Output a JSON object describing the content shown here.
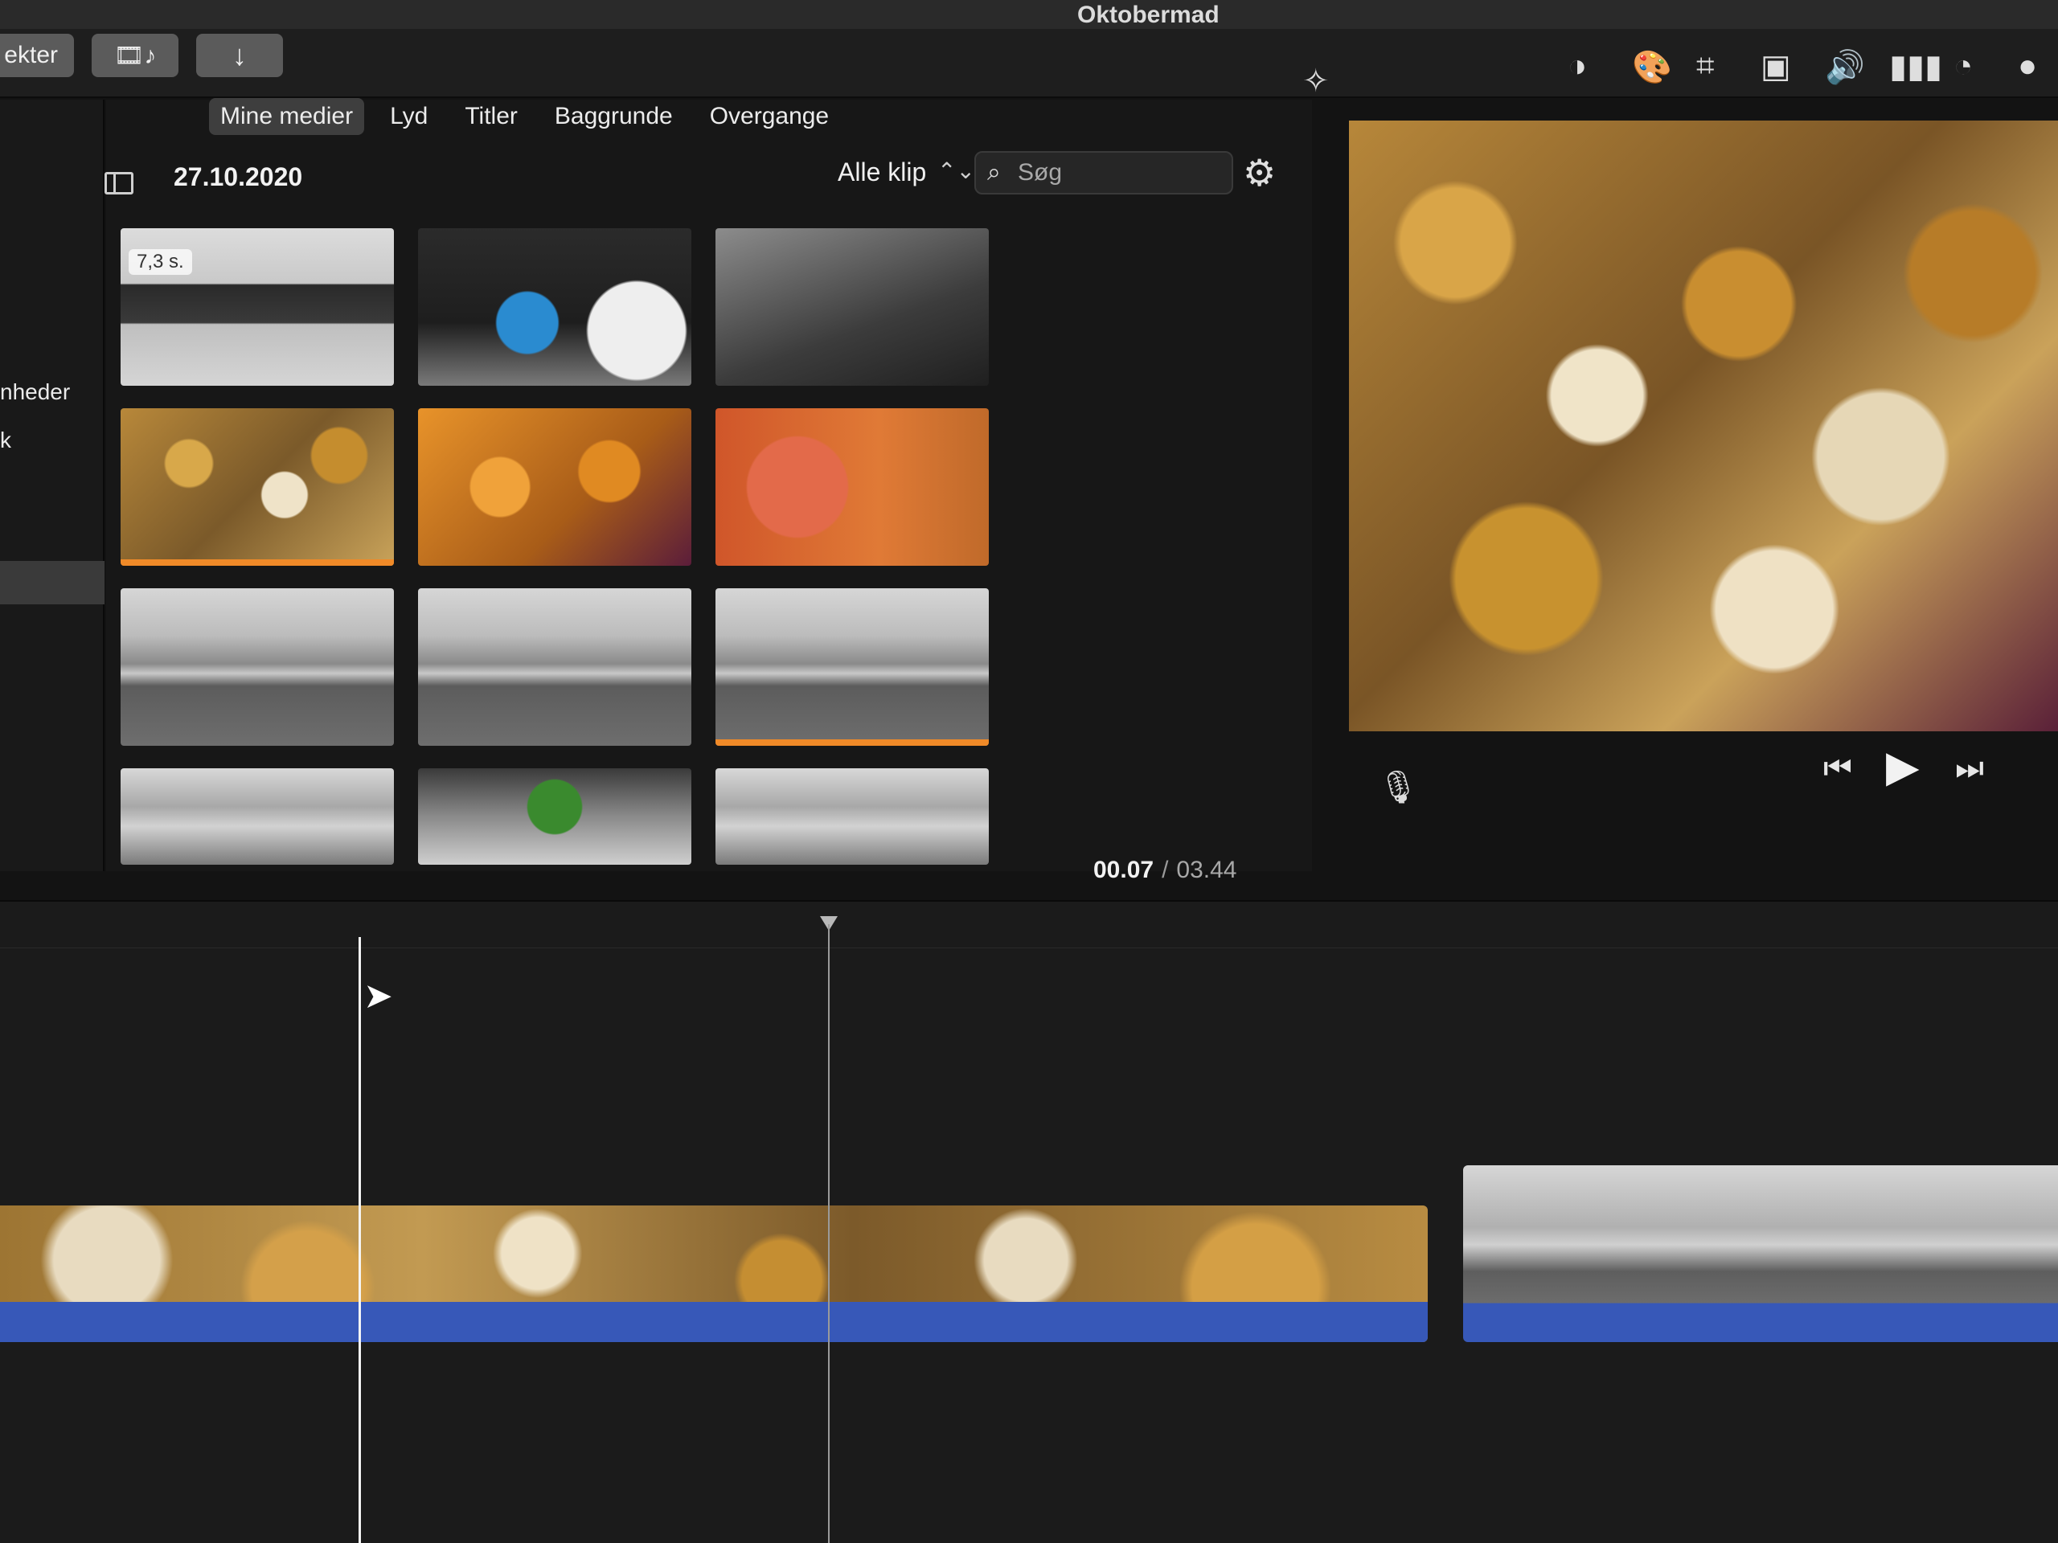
{
  "window": {
    "title": "Oktobermad"
  },
  "toolbar": {
    "projects_label": "ekter",
    "media_icon": "film-music-icon",
    "import_icon": "download-arrow-icon"
  },
  "sidebar": {
    "items": [
      "nheder",
      "k"
    ]
  },
  "browser": {
    "tabs": [
      {
        "label": "Mine medier",
        "active": true
      },
      {
        "label": "Lyd",
        "active": false
      },
      {
        "label": "Titler",
        "active": false
      },
      {
        "label": "Baggrunde",
        "active": false
      },
      {
        "label": "Overgange",
        "active": false
      }
    ],
    "date": "27.10.2020",
    "filter": "Alle klip",
    "search": {
      "placeholder": "Søg",
      "value": ""
    },
    "clips": [
      {
        "type": "laptop",
        "duration": "7,3 s.",
        "used": false
      },
      {
        "type": "cooking",
        "used": false
      },
      {
        "type": "counter",
        "used": false
      },
      {
        "type": "mushrooms",
        "used": true
      },
      {
        "type": "mushrooms-orange",
        "used": false
      },
      {
        "type": "orange",
        "used": false
      },
      {
        "type": "sea",
        "used": false
      },
      {
        "type": "sea",
        "used": false
      },
      {
        "type": "sea",
        "used": true
      },
      {
        "type": "sea-rocks",
        "used": false
      },
      {
        "type": "garden",
        "used": false
      },
      {
        "type": "sea-waves",
        "used": false
      }
    ]
  },
  "viewer": {
    "tools": [
      "magic-wand-icon",
      "color-balance-icon",
      "color-palette-icon",
      "crop-icon",
      "stabilization-icon",
      "volume-icon",
      "equalizer-icon",
      "speed-icon",
      "filter-icon"
    ]
  },
  "timecode": {
    "current": "00.07",
    "separator": "/",
    "total": "03.44"
  }
}
